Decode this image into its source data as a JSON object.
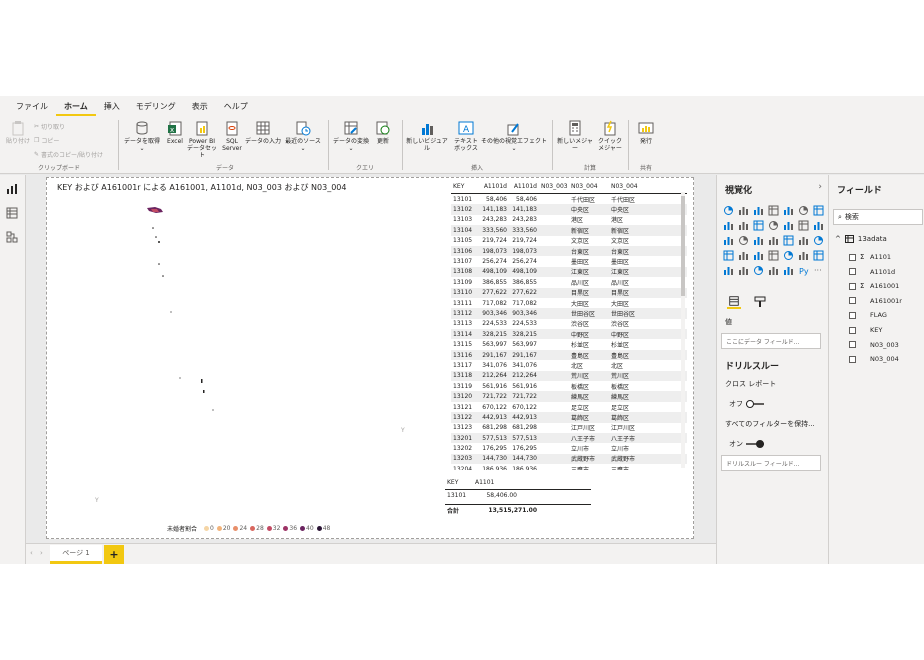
{
  "menu": [
    "ファイル",
    "ホーム",
    "挿入",
    "モデリング",
    "表示",
    "ヘルプ"
  ],
  "menu_active": "ホーム",
  "clipboard": {
    "paste": "貼り付け",
    "cut": "切り取り",
    "copy": "コピー",
    "format_copy": "書式のコピー/貼り付け",
    "label": "クリップボード"
  },
  "data_group": {
    "get_data": "データを取得",
    "excel": "Excel",
    "powerbi": "Power BI データセット",
    "sql": "SQL Server",
    "enter": "データの入力",
    "recent": "最近のソース",
    "label": "データ"
  },
  "query_group": {
    "transform": "データの変換",
    "refresh": "更新",
    "label": "クエリ"
  },
  "insert_group": {
    "new_visual": "新しいビジュアル",
    "textbox": "テキスト ボックス",
    "more_visuals": "その他の視覚エフェクト",
    "label": "挿入"
  },
  "calc_group": {
    "new_measure": "新しいメジャー",
    "quick_measure": "クイック メジャー",
    "label": "計算"
  },
  "share_group": {
    "publish": "発行",
    "label": "共有"
  },
  "visual_title": "KEY および A161001r による A161001, A1101d, N03_003 および N03_004",
  "map_labels": {
    "y1": "Y",
    "y2": "Y"
  },
  "legend": {
    "title": "未婚者割合",
    "items": [
      {
        "label": "0",
        "color": "#f5d5a5"
      },
      {
        "label": "20",
        "color": "#f2b37a"
      },
      {
        "label": "24",
        "color": "#e88f6a"
      },
      {
        "label": "28",
        "color": "#d9675f"
      },
      {
        "label": "32",
        "color": "#c24a63"
      },
      {
        "label": "36",
        "color": "#9d3366"
      },
      {
        "label": "40",
        "color": "#6b2460"
      },
      {
        "label": "48",
        "color": "#2b1535"
      }
    ]
  },
  "table1": {
    "headers": [
      "KEY",
      "A1101d",
      "A1101d",
      "N03_003",
      "N03_004",
      "N03_004"
    ],
    "rows": [
      [
        "13101",
        "58,406",
        "58,406",
        "",
        "千代田区",
        "千代田区"
      ],
      [
        "13102",
        "141,183",
        "141,183",
        "",
        "中央区",
        "中央区"
      ],
      [
        "13103",
        "243,283",
        "243,283",
        "",
        "港区",
        "港区"
      ],
      [
        "13104",
        "333,560",
        "333,560",
        "",
        "新宿区",
        "新宿区"
      ],
      [
        "13105",
        "219,724",
        "219,724",
        "",
        "文京区",
        "文京区"
      ],
      [
        "13106",
        "198,073",
        "198,073",
        "",
        "台東区",
        "台東区"
      ],
      [
        "13107",
        "256,274",
        "256,274",
        "",
        "墨田区",
        "墨田区"
      ],
      [
        "13108",
        "498,109",
        "498,109",
        "",
        "江東区",
        "江東区"
      ],
      [
        "13109",
        "386,855",
        "386,855",
        "",
        "品川区",
        "品川区"
      ],
      [
        "13110",
        "277,622",
        "277,622",
        "",
        "目黒区",
        "目黒区"
      ],
      [
        "13111",
        "717,082",
        "717,082",
        "",
        "大田区",
        "大田区"
      ],
      [
        "13112",
        "903,346",
        "903,346",
        "",
        "世田谷区",
        "世田谷区"
      ],
      [
        "13113",
        "224,533",
        "224,533",
        "",
        "渋谷区",
        "渋谷区"
      ],
      [
        "13114",
        "328,215",
        "328,215",
        "",
        "中野区",
        "中野区"
      ],
      [
        "13115",
        "563,997",
        "563,997",
        "",
        "杉並区",
        "杉並区"
      ],
      [
        "13116",
        "291,167",
        "291,167",
        "",
        "豊島区",
        "豊島区"
      ],
      [
        "13117",
        "341,076",
        "341,076",
        "",
        "北区",
        "北区"
      ],
      [
        "13118",
        "212,264",
        "212,264",
        "",
        "荒川区",
        "荒川区"
      ],
      [
        "13119",
        "561,916",
        "561,916",
        "",
        "板橋区",
        "板橋区"
      ],
      [
        "13120",
        "721,722",
        "721,722",
        "",
        "練馬区",
        "練馬区"
      ],
      [
        "13121",
        "670,122",
        "670,122",
        "",
        "足立区",
        "足立区"
      ],
      [
        "13122",
        "442,913",
        "442,913",
        "",
        "葛飾区",
        "葛飾区"
      ],
      [
        "13123",
        "681,298",
        "681,298",
        "",
        "江戸川区",
        "江戸川区"
      ],
      [
        "13201",
        "577,513",
        "577,513",
        "",
        "八王子市",
        "八王子市"
      ],
      [
        "13202",
        "176,295",
        "176,295",
        "",
        "立川市",
        "立川市"
      ],
      [
        "13203",
        "144,730",
        "144,730",
        "",
        "武蔵野市",
        "武蔵野市"
      ],
      [
        "13204",
        "186,936",
        "186,936",
        "",
        "三鷹市",
        "三鷹市"
      ]
    ]
  },
  "table2": {
    "headers": [
      "KEY",
      "A1101"
    ],
    "rows": [
      [
        "13101",
        "58,406.00"
      ]
    ],
    "total_label": "合計",
    "total_value": "13,515,271.00"
  },
  "pages": {
    "tab": "ページ 1",
    "add": "+"
  },
  "viz_pane": {
    "title": "視覚化",
    "values_label": "値",
    "values_placeholder": "ここにデータ フィールド...",
    "drill_title": "ドリルスルー",
    "cross_report": "クロス レポート",
    "cross_state": "オフ",
    "keep_filters": "すべてのフィルターを保持...",
    "keep_state": "オン",
    "drill_placeholder": "ドリルスルー フィールド..."
  },
  "fields_pane": {
    "title": "フィールド",
    "search_placeholder": "検索",
    "table_name": "13adata",
    "fields": [
      {
        "name": "A1101",
        "sigma": "Σ"
      },
      {
        "name": "A1101d",
        "sigma": ""
      },
      {
        "name": "A161001",
        "sigma": "Σ"
      },
      {
        "name": "A161001r",
        "sigma": ""
      },
      {
        "name": "FLAG",
        "sigma": ""
      },
      {
        "name": "KEY",
        "sigma": ""
      },
      {
        "name": "N03_003",
        "sigma": ""
      },
      {
        "name": "N03_004",
        "sigma": ""
      }
    ]
  }
}
